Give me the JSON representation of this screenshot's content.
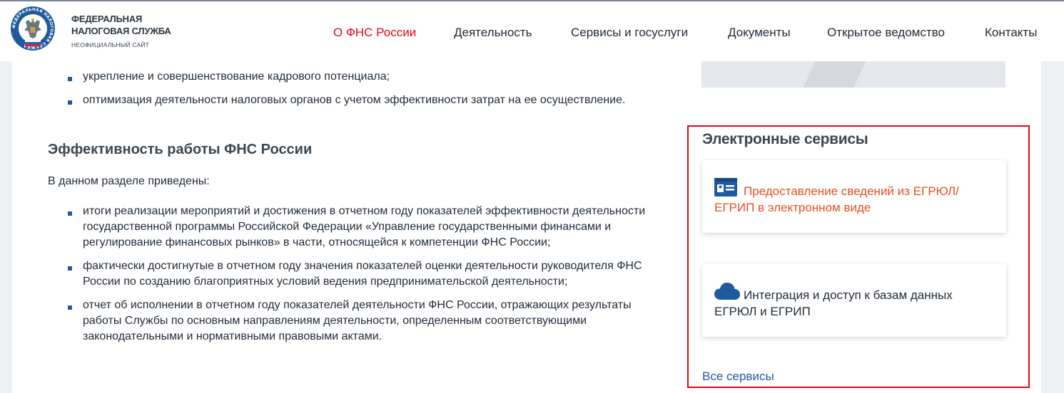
{
  "header": {
    "logo": {
      "line1": "ФЕДЕРАЛЬНАЯ",
      "line2": "НАЛОГОВАЯ СЛУЖБА",
      "line3": "НЕОФИЦИАЛЬНЫЙ САЙТ",
      "emblem_ring_text": "ФЕДЕРАЛЬНАЯ НАЛОГОВАЯ СЛУЖБА",
      "emblem_icon": "double-headed-eagle-emblem"
    },
    "nav": [
      {
        "label": "О ФНС России",
        "active": true
      },
      {
        "label": "Деятельность",
        "active": false
      },
      {
        "label": "Сервисы и госуслуги",
        "active": false
      },
      {
        "label": "Документы",
        "active": false
      },
      {
        "label": "Открытое ведомство",
        "active": false
      },
      {
        "label": "Контакты",
        "active": false
      }
    ]
  },
  "content": {
    "top_bullets": [
      "укрепление и совершенствование кадрового потенциала;",
      "оптимизация деятельности налоговых органов с учетом эффективности затрат на ее осуществление."
    ],
    "section_title": "Эффективность работы ФНС России",
    "intro": "В данном разделе приведены:",
    "bullets": [
      "итоги реализации мероприятий и достижения в отчетном году показателей эффективности деятельности государственной программы Российской Федерации «Управление государственными финансами и регулирование финансовых рынков» в части, относящейся к компетенции ФНС России;",
      "фактически достигнутые в отчетном году значения показателей оценки деятельности руководителя ФНС России по созданию благоприятных условий ведения предпринимательской деятельности;",
      "отчет об исполнении в отчетном году показателей деятельности ФНС России, отражающих результаты работы Службы по основным направлениям деятельности, определенным соответствующими законодательными и нормативными правовыми актами."
    ]
  },
  "sidebar": {
    "services_title": "Электронные сервисы",
    "cards": [
      {
        "label": "Предоставление сведений из ЕГРЮЛ/ ЕГРИП в электронном виде",
        "icon": "id-card-icon"
      },
      {
        "label": "Интеграция и доступ к базам данных ЕГРЮЛ и ЕГРИП",
        "icon": "cloud-icon"
      }
    ],
    "all_services": "Все сервисы"
  },
  "colors": {
    "accent_red": "#e30613",
    "link_blue": "#1f5a9e",
    "card_orange": "#e5501f",
    "text_dark": "#1f2a36"
  }
}
